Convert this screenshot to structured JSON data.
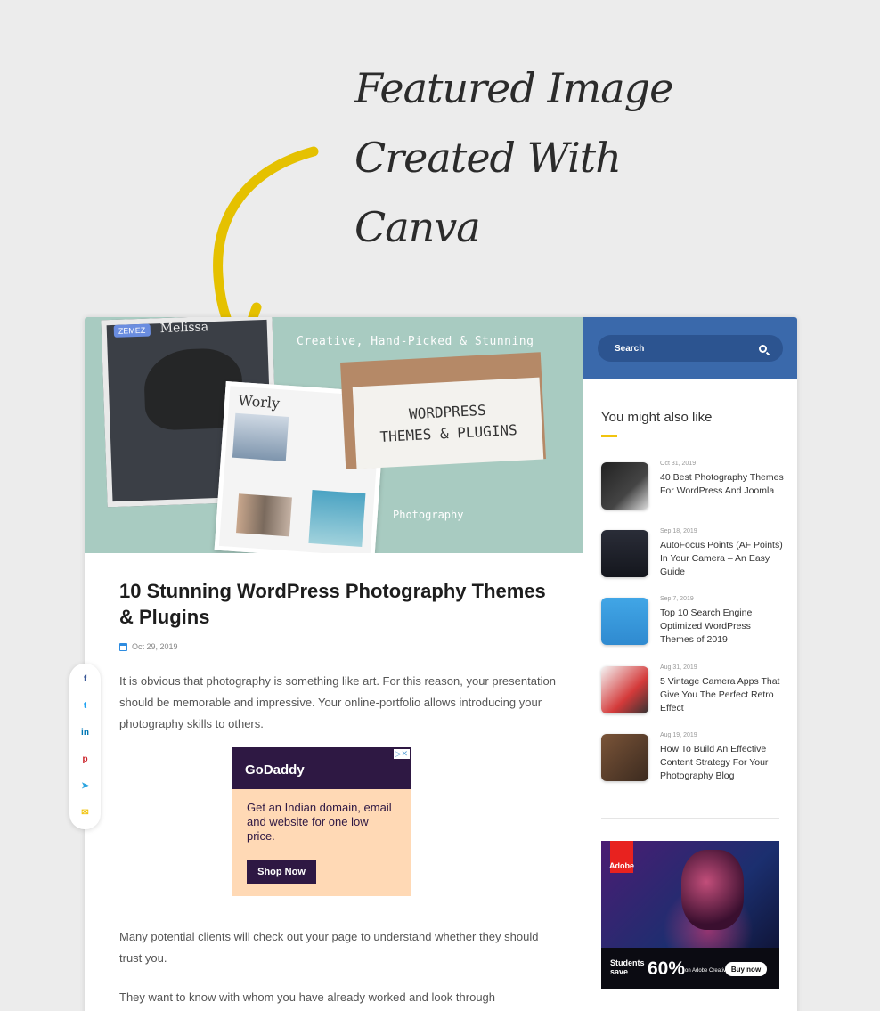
{
  "annotation": {
    "lines": [
      "Featured Image",
      "Created With",
      "Canva"
    ],
    "arrow_color": "#e5c100"
  },
  "hero": {
    "tagline": "Creative, Hand-Picked & Stunning",
    "note_line1": "WORDPRESS",
    "note_line2": "THEMES & PLUGINS",
    "caption": "Photography",
    "badge": "ZEMEZ",
    "shot1_title": "Melissa",
    "shot2_title": "Worly"
  },
  "article": {
    "title": "10 Stunning WordPress Photography Themes & Plugins",
    "date": "Oct 29, 2019",
    "intro": "It is obvious that photography is something like art. For this reason, your presentation should be memorable and impressive. Your online-portfolio allows introducing your photography skills to others.",
    "para2": "Many potential clients will check out your page to understand whether they should trust you.",
    "para3": "They want to know with whom you have already worked and look through"
  },
  "ad": {
    "brand": "GoDaddy",
    "copy": "Get an Indian domain, email and website for one low price.",
    "cta": "Shop Now"
  },
  "share": {
    "icons": [
      "facebook-icon",
      "twitter-icon",
      "linkedin-icon",
      "pinterest-icon",
      "telegram-icon",
      "email-icon"
    ],
    "glyphs": [
      "f",
      "t",
      "in",
      "p",
      "➤",
      "✉"
    ],
    "colors": [
      "#3b5998",
      "#1da1f2",
      "#0077b5",
      "#cb2027",
      "#2ca5e0",
      "#f1c40f"
    ]
  },
  "sidebar": {
    "search_placeholder": "Search",
    "widget_title": "You might also like",
    "accent": "#f1c40f",
    "header_color": "#3a69ab",
    "posts": [
      {
        "date": "Oct 31, 2019",
        "title": "40 Best Photography Themes For WordPress And Joomla"
      },
      {
        "date": "Sep 18, 2019",
        "title": "AutoFocus Points (AF Points) In Your Camera – An Easy Guide"
      },
      {
        "date": "Sep 7, 2019",
        "title": "Top 10 Search Engine Optimized WordPress Themes of 2019"
      },
      {
        "date": "Aug 31, 2019",
        "title": "5 Vintage Camera Apps That Give You The Perfect Retro Effect"
      },
      {
        "date": "Aug 19, 2019",
        "title": "How To Build An Effective Content Strategy For Your Photography Blog"
      }
    ],
    "adobe_ad": {
      "logo": "Adobe",
      "students": "Students",
      "save": "save",
      "amount": "60%",
      "sub": "on Adobe Creative Cloud",
      "cta": "Buy now"
    }
  }
}
